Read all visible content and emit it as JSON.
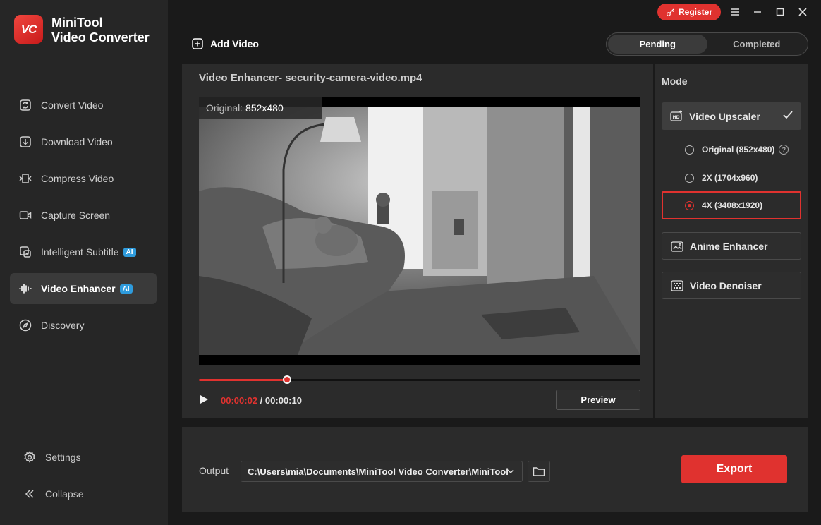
{
  "app": {
    "brand_line1": "MiniTool",
    "brand_line2": "Video Converter",
    "logo_text": "VC",
    "accent": "#e0322f"
  },
  "sidebar": {
    "items": [
      {
        "label": "Convert Video",
        "icon": "convert-icon"
      },
      {
        "label": "Download Video",
        "icon": "download-icon"
      },
      {
        "label": "Compress Video",
        "icon": "compress-icon"
      },
      {
        "label": "Capture Screen",
        "icon": "camera-icon"
      },
      {
        "label": "Intelligent Subtitle",
        "icon": "subtitle-icon",
        "badge": "AI"
      },
      {
        "label": "Video Enhancer",
        "icon": "waveform-icon",
        "badge": "AI",
        "active": true
      },
      {
        "label": "Discovery",
        "icon": "compass-icon"
      }
    ],
    "settings": "Settings",
    "collapse": "Collapse"
  },
  "topbar": {
    "register": "Register",
    "add_video": "Add Video",
    "tab_pending": "Pending",
    "tab_completed": "Completed"
  },
  "enhancer": {
    "title": "Video Enhancer- security-camera-video.mp4",
    "original_prefix": "Original:",
    "original_res": "852x480",
    "progress": 0.2,
    "time_current": "00:00:02",
    "time_separator": "/",
    "time_total": "00:00:10",
    "preview": "Preview"
  },
  "mode": {
    "title": "Mode",
    "upscaler": "Video Upscaler",
    "opt_original": "Original (852x480)",
    "opt_2x": "2X (1704x960)",
    "opt_4x": "4X (3408x1920)",
    "anime": "Anime Enhancer",
    "denoiser": "Video Denoiser"
  },
  "output": {
    "label": "Output",
    "path": "C:\\Users\\mia\\Documents\\MiniTool Video Converter\\MiniTool",
    "export": "Export"
  }
}
